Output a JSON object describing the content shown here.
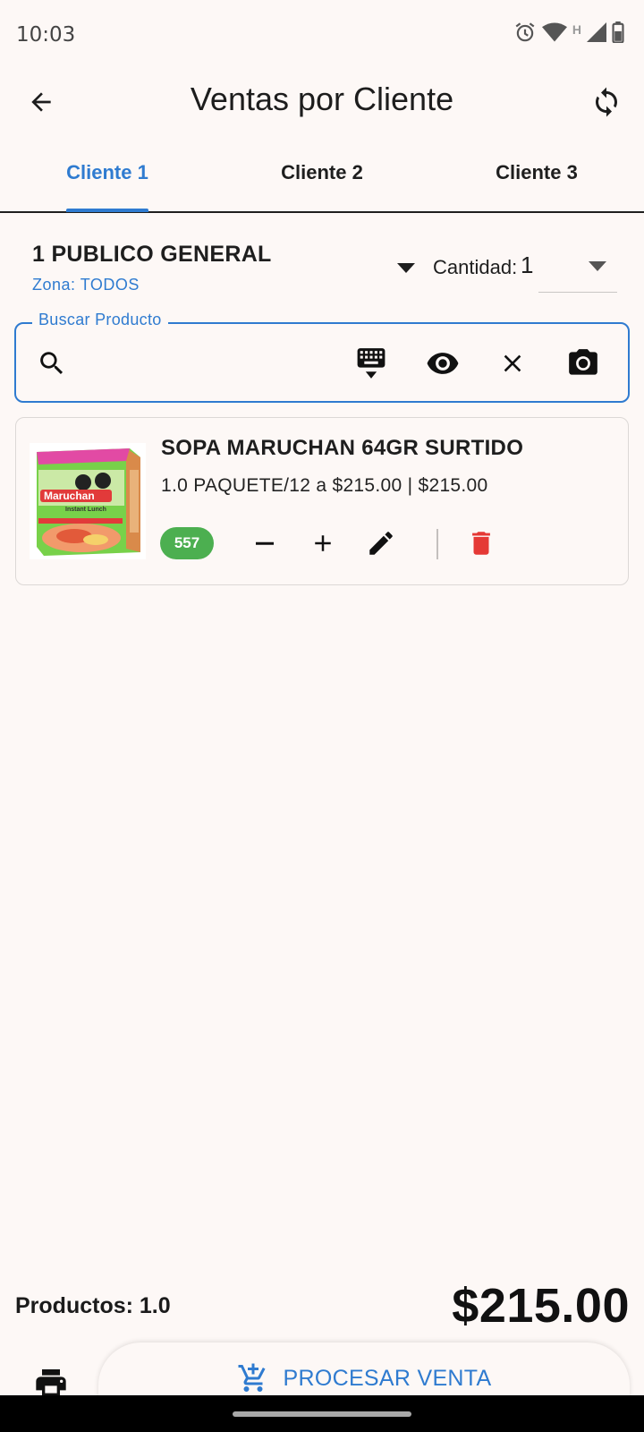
{
  "status_bar": {
    "time": "10:03",
    "icons": [
      "alarm-icon",
      "wifi-icon",
      "h-signal-icon",
      "cell-signal-icon",
      "battery-icon"
    ],
    "network_letter": "H"
  },
  "app_bar": {
    "title": "Ventas por Cliente",
    "back_icon": "arrow-back-icon",
    "sync_icon": "sync-icon"
  },
  "tabs": [
    {
      "label": "Cliente 1",
      "active": true
    },
    {
      "label": "Cliente 2",
      "active": false
    },
    {
      "label": "Cliente 3",
      "active": false
    }
  ],
  "customer": {
    "name": "1 PUBLICO GENERAL",
    "zone": "Zona: TODOS",
    "quantity_label": "Cantidad:",
    "quantity_value": "1"
  },
  "search": {
    "label": "Buscar Producto",
    "value": "",
    "actions": [
      "keyboard-icon",
      "eye-icon",
      "close-icon",
      "camera-icon"
    ]
  },
  "cart_items": [
    {
      "name": "SOPA MARUCHAN 64GR SURTIDO",
      "detail": "1.0 PAQUETE/12 a $215.00 | $215.00",
      "stock": "557",
      "image_brand": "Maruchan",
      "image_text": "Instant Lunch"
    }
  ],
  "footer": {
    "products_count": "Productos: 1.0",
    "total": "$215.00",
    "process_label": "PROCESAR VENTA"
  },
  "colors": {
    "accent": "#2f7bd0",
    "badge": "#4caf50",
    "delete": "#e53935",
    "background": "#fdf8f6"
  }
}
